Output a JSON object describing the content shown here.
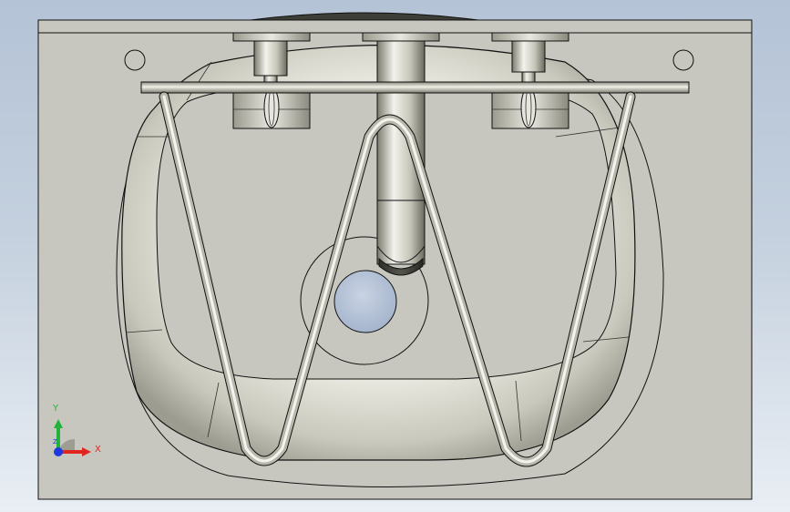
{
  "viewport": {
    "background_top": "#b4c3d6",
    "background_bottom": "#e9eef4",
    "panel_fill": "#c7c7c0",
    "edge_color": "#111111",
    "metal_light": "#f4f4ee",
    "metal_mid": "#c9c9bd",
    "metal_dark": "#6e6e62"
  },
  "model": {
    "parts": [
      "countertop-panel",
      "wash-basin",
      "drain-hole",
      "waste-pipe",
      "tap-left",
      "tap-right",
      "towel-rail",
      "wire-rack"
    ]
  },
  "triad": {
    "x_label": "X",
    "y_label": "Y",
    "z_label": "Z",
    "x_color": "#e0261e",
    "y_color": "#1fb43a",
    "z_color": "#1f39e0"
  }
}
